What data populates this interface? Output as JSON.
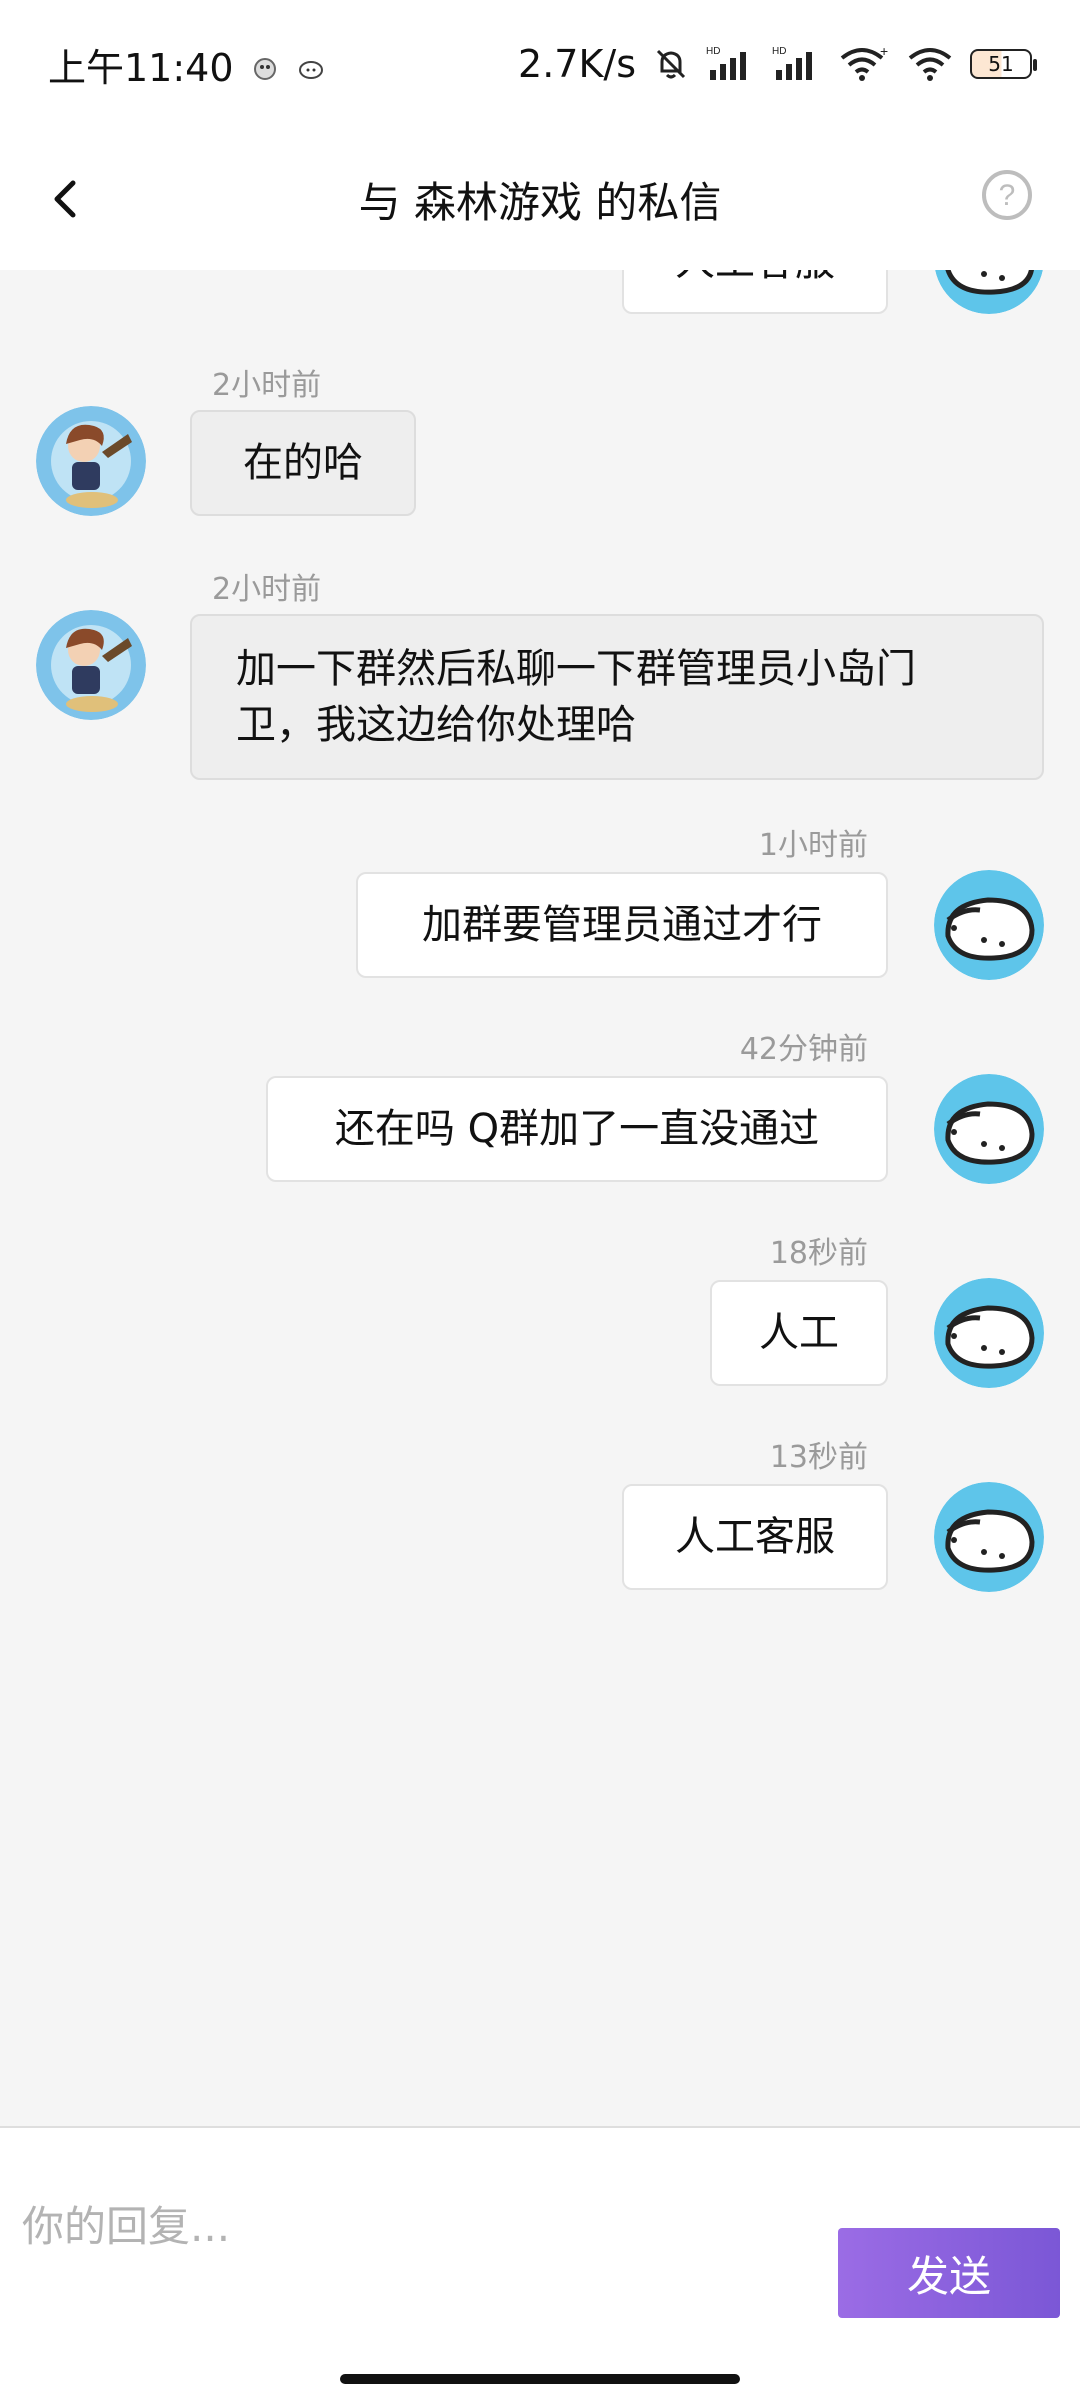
{
  "status_bar": {
    "time": "上午11:40",
    "network_speed": "2.7K/s",
    "battery": "51"
  },
  "header": {
    "title": "与 森林游戏 的私信",
    "back_icon": "chevron-left-icon",
    "help_icon": "question-circle-icon"
  },
  "messages": [
    {
      "direction": "out",
      "text": "人工客服",
      "time": "",
      "partial": true
    },
    {
      "direction": "in",
      "time": "2小时前",
      "text": "在的哈"
    },
    {
      "direction": "in",
      "time": "2小时前",
      "text_line1": "加一下群然后私聊一下群管理员小岛门",
      "text_line2": "卫，我这边给你处理哈"
    },
    {
      "direction": "out",
      "time": "1小时前",
      "text": "加群要管理员通过才行"
    },
    {
      "direction": "out",
      "time": "42分钟前",
      "text": "还在吗 Q群加了一直没通过"
    },
    {
      "direction": "out",
      "time": "18秒前",
      "text": "人工"
    },
    {
      "direction": "out",
      "time": "13秒前",
      "text": "人工客服"
    }
  ],
  "reply": {
    "placeholder": "你的回复...",
    "value": "",
    "send_label": "发送"
  },
  "colors": {
    "send_button": "#8a62de",
    "background": "#f5f5f5",
    "self_avatar": "#5ec5ea"
  }
}
